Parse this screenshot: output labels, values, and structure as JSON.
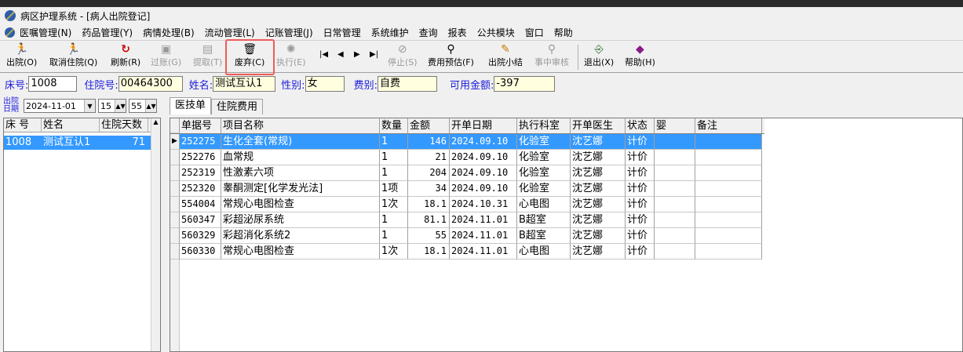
{
  "window": {
    "title": "病区护理系统 - [病人出院登记]"
  },
  "menu": [
    "医嘱管理(N)",
    "药品管理(Y)",
    "病情处理(B)",
    "流动管理(L)",
    "记账管理(J)",
    "日常管理",
    "系统维护",
    "查询",
    "报表",
    "公共模块",
    "窗口",
    "帮助"
  ],
  "toolbar": {
    "discharge": "出院(O)",
    "cancel_discharge": "取消住院(Q)",
    "refresh": "刷新(R)",
    "transfer": "过账(G)",
    "pick": "提取(T)",
    "discard": "废弃(C)",
    "execute": "执行(E)",
    "stop": "停止(S)",
    "cost_estimate": "费用预估(F)",
    "discharge_summary": "出院小结",
    "review": "事中审核",
    "exit": "退出(X)",
    "help": "帮助(H)"
  },
  "patient": {
    "bed_label": "床号:",
    "bed": "1008",
    "admission_label": "住院号:",
    "admission": "00464300",
    "name_label": "姓名:",
    "name": "测试互认1",
    "sex_label": "性别:",
    "sex": "女",
    "fee_label": "费别:",
    "fee": "自费",
    "balance_label": "可用金额:",
    "balance": "-397"
  },
  "discharge_date": {
    "label_top": "出院",
    "label_bottom": "日期",
    "date": "2024-11-01",
    "hour": "15",
    "minute": "55"
  },
  "tabs": [
    "医技单",
    "住院费用"
  ],
  "patient_list": {
    "headers": [
      "床 号",
      "姓名",
      "住院天数"
    ],
    "rows": [
      {
        "bed": "1008",
        "name": "测试互认1",
        "days": "71"
      }
    ]
  },
  "grid": {
    "headers": [
      "单据号",
      "项目名称",
      "数量",
      "金额",
      "开单日期",
      "执行科室",
      "开单医生",
      "状态",
      "婴",
      "备注"
    ],
    "rows": [
      {
        "id": "252275",
        "item": "生化全套(常规)",
        "qty": "1",
        "amount": "146",
        "date": "2024.09.10",
        "dept": "化验室",
        "doctor": "沈艺娜",
        "status": "计价",
        "baby": "",
        "note": ""
      },
      {
        "id": "252276",
        "item": "血常规",
        "qty": "1",
        "amount": "21",
        "date": "2024.09.10",
        "dept": "化验室",
        "doctor": "沈艺娜",
        "status": "计价",
        "baby": "",
        "note": ""
      },
      {
        "id": "252319",
        "item": "性激素六项",
        "qty": "1",
        "amount": "204",
        "date": "2024.09.10",
        "dept": "化验室",
        "doctor": "沈艺娜",
        "status": "计价",
        "baby": "",
        "note": ""
      },
      {
        "id": "252320",
        "item": "睾酮测定[化学发光法]",
        "qty": "1项",
        "amount": "34",
        "date": "2024.09.10",
        "dept": "化验室",
        "doctor": "沈艺娜",
        "status": "计价",
        "baby": "",
        "note": ""
      },
      {
        "id": "554004",
        "item": "常规心电图检查",
        "qty": "1次",
        "amount": "18.1",
        "date": "2024.10.31",
        "dept": "心电图",
        "doctor": "沈艺娜",
        "status": "计价",
        "baby": "",
        "note": ""
      },
      {
        "id": "560347",
        "item": "彩超泌尿系统",
        "qty": "1",
        "amount": "81.1",
        "date": "2024.11.01",
        "dept": "B超室",
        "doctor": "沈艺娜",
        "status": "计价",
        "baby": "",
        "note": ""
      },
      {
        "id": "560329",
        "item": "彩超消化系统2",
        "qty": "1",
        "amount": "55",
        "date": "2024.11.01",
        "dept": "B超室",
        "doctor": "沈艺娜",
        "status": "计价",
        "baby": "",
        "note": ""
      },
      {
        "id": "560330",
        "item": "常规心电图检查",
        "qty": "1次",
        "amount": "18.1",
        "date": "2024.11.01",
        "dept": "心电图",
        "doctor": "沈艺娜",
        "status": "计价",
        "baby": "",
        "note": ""
      }
    ]
  },
  "colors": {
    "selection": "#3399ff",
    "label_blue": "#1a1adc",
    "highlight_red": "#f05a5a",
    "field_yellow": "#ffffe0"
  }
}
